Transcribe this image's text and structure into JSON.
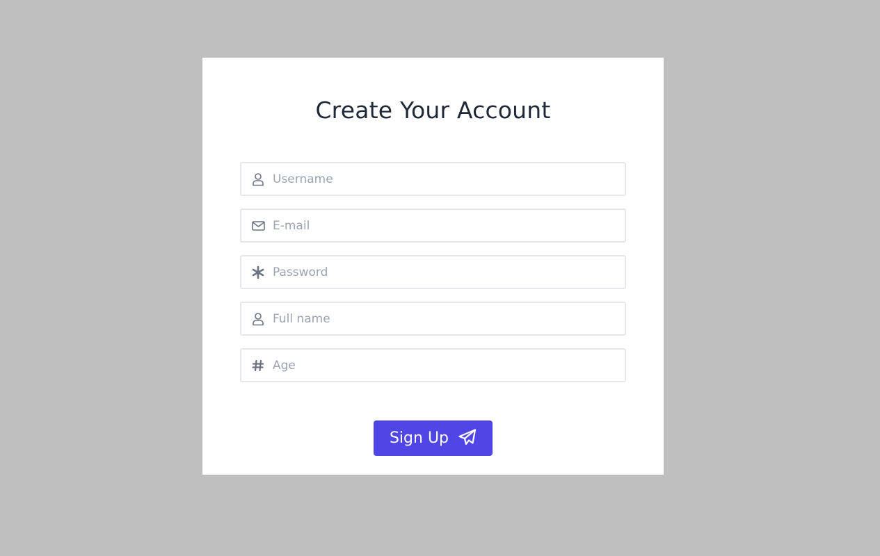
{
  "form": {
    "title": "Create Your Account",
    "fields": [
      {
        "placeholder": "Username",
        "value": "",
        "icon": "user-icon"
      },
      {
        "placeholder": "E-mail",
        "value": "",
        "icon": "mail-icon"
      },
      {
        "placeholder": "Password",
        "value": "",
        "icon": "asterisk-icon"
      },
      {
        "placeholder": "Full name",
        "value": "",
        "icon": "user-icon"
      },
      {
        "placeholder": "Age",
        "value": "",
        "icon": "hash-icon"
      }
    ],
    "submit_label": "Sign Up",
    "submit_icon": "paper-plane-icon"
  },
  "colors": {
    "background": "#bfbfbf",
    "card": "#ffffff",
    "accent": "#4f46e5",
    "title_text": "#1f2937",
    "placeholder": "#9ca3af",
    "icon": "#6b7280",
    "field_border": "#e5e7eb"
  }
}
